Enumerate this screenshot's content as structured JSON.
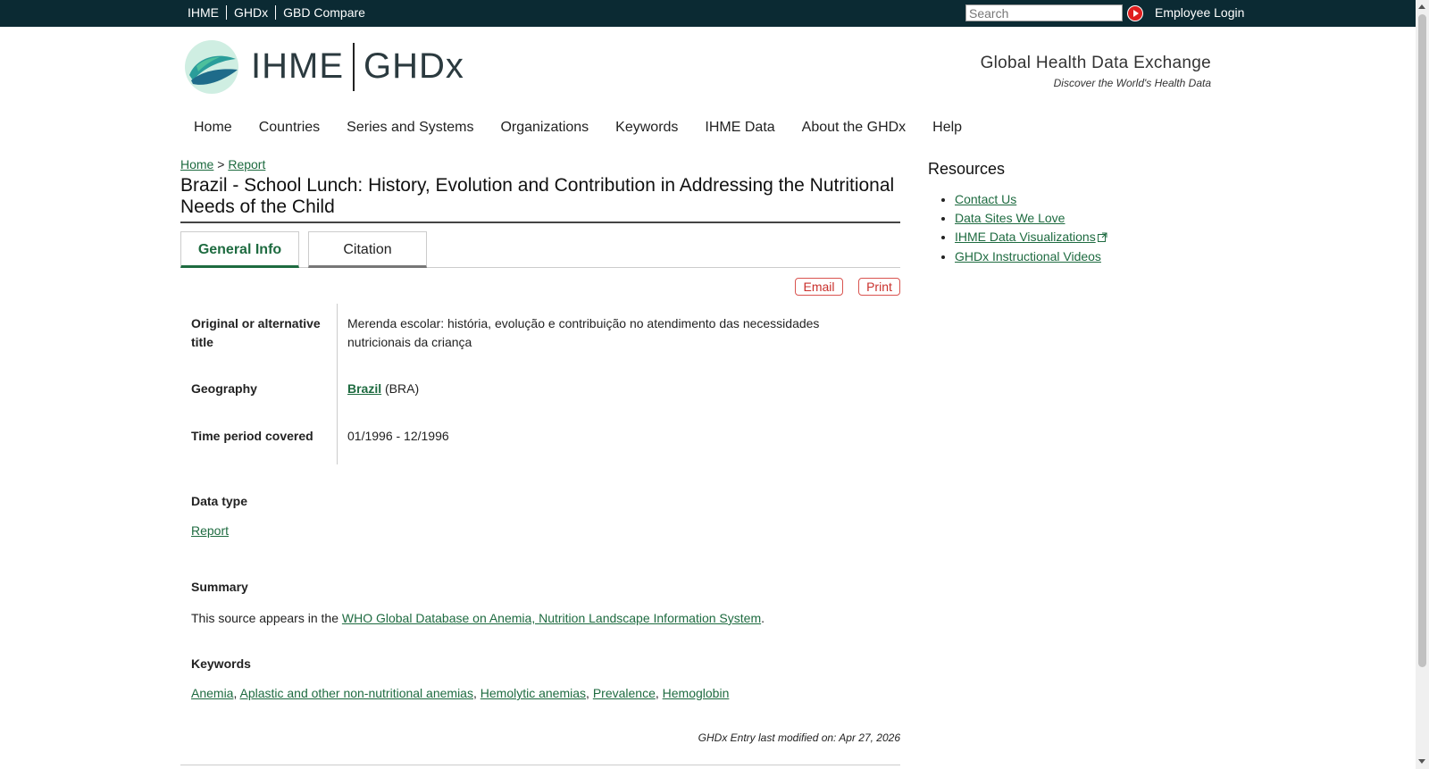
{
  "topbar": {
    "links": [
      "IHME",
      "GHDx",
      "GBD Compare"
    ],
    "search_placeholder": "Search",
    "employee_login": "Employee Login"
  },
  "header": {
    "logo_text_left": "IHME",
    "logo_text_right": "GHDx",
    "tagline_title": "Global Health Data Exchange",
    "tagline_sub": "Discover the World's Health Data"
  },
  "nav": {
    "items": [
      "Home",
      "Countries",
      "Series and Systems",
      "Organizations",
      "Keywords",
      "IHME Data",
      "About the GHDx",
      "Help"
    ]
  },
  "breadcrumb": {
    "home": "Home",
    "separator": ">",
    "current": "Report"
  },
  "page": {
    "title": "Brazil - School Lunch: History, Evolution and Contribution in Addressing the Nutritional Needs of the Child",
    "tabs": [
      "General Info",
      "Citation"
    ],
    "email_label": "Email",
    "print_label": "Print"
  },
  "info": {
    "original_title_label": "Original or alternative title",
    "original_title_value": "Merenda escolar: história, evolução e contribuição no atendimento das necessidades nutricionais da criança",
    "geography_label": "Geography",
    "geography_link": "Brazil",
    "geography_code": "(BRA)",
    "time_period_label": "Time period covered",
    "time_period_value": "01/1996 - 12/1996"
  },
  "data_type": {
    "heading": "Data type",
    "value": "Report"
  },
  "summary": {
    "heading": "Summary",
    "text_before": "This source appears in the ",
    "link": "WHO Global Database on Anemia, Nutrition Landscape Information System",
    "text_after": "."
  },
  "keywords": {
    "heading": "Keywords",
    "items": [
      "Anemia",
      "Aplastic and other non-nutritional anemias",
      "Hemolytic anemias",
      "Prevalence",
      "Hemoglobin"
    ],
    "separator": ", "
  },
  "modified": "GHDx Entry last modified on: Apr 27, 2026",
  "resources": {
    "title": "Resources",
    "items": [
      "Contact Us",
      "Data Sites We Love",
      "IHME Data Visualizations",
      "GHDx Instructional Videos"
    ]
  },
  "colors": {
    "topbar": "#0b2a33",
    "link_green": "#1e6b40",
    "button_red": "#c9302c",
    "logo_teal": "#2a9d9a"
  }
}
